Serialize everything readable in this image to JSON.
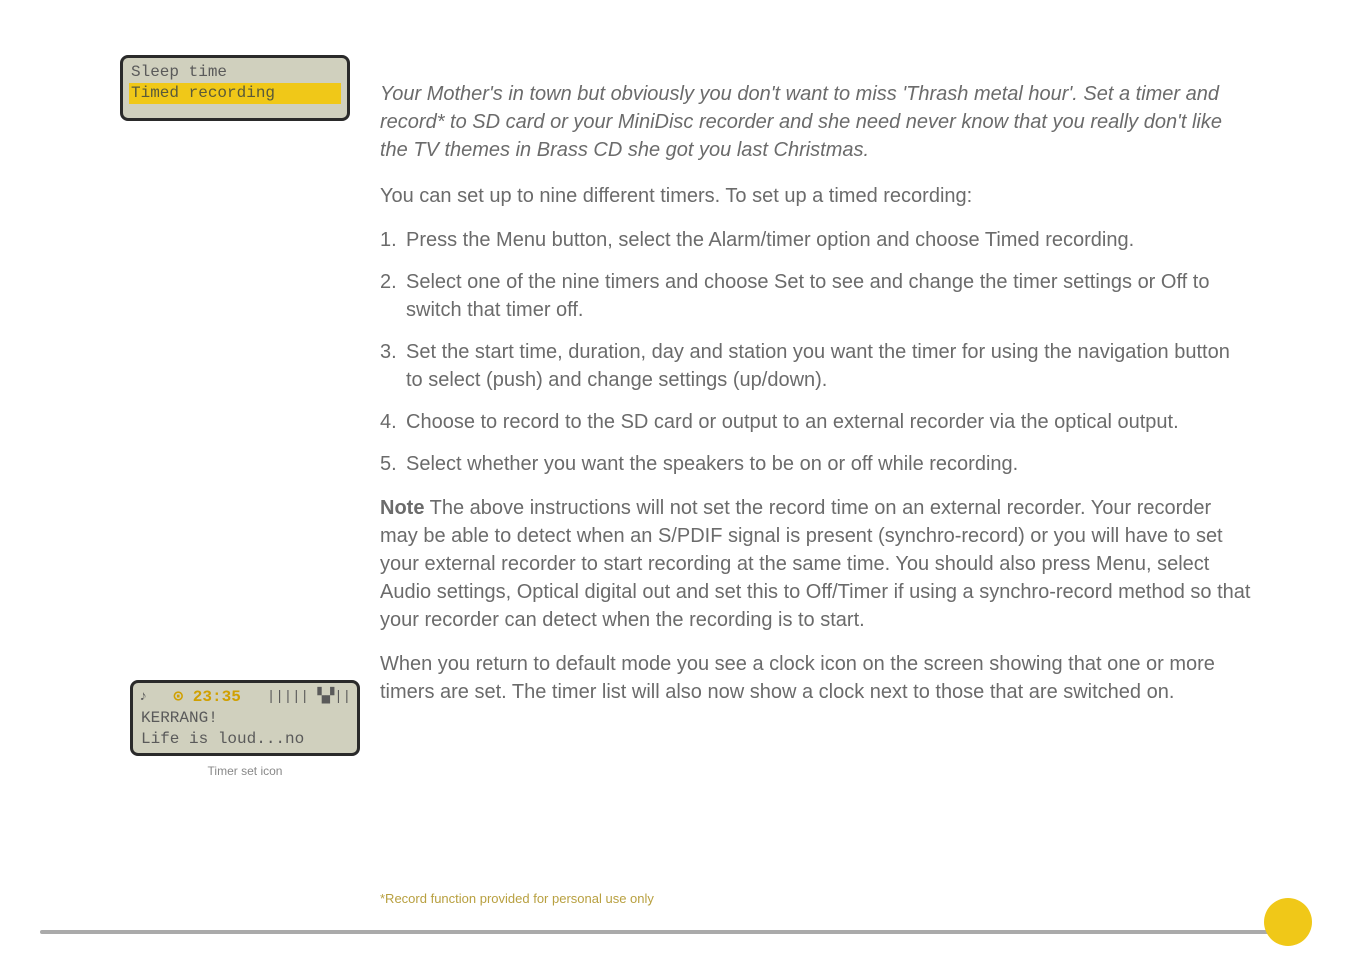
{
  "screen_top": {
    "line1": "Sleep time",
    "line2": "Timed recording"
  },
  "screen_bottom": {
    "left_symbol": "♪",
    "clock_icon": "⊙",
    "time": "23:35",
    "bars": "||||| ▚▞||",
    "station": "KERRANG!",
    "scroll": "Life is loud...no"
  },
  "caption_bottom": "Timer set icon",
  "intro": "Your Mother's in town but obviously you don't want to miss 'Thrash metal hour'. Set a timer and record* to SD card or your MiniDisc recorder and she need never know that you really don't like the TV themes in Brass CD she got you last Christmas.",
  "lead": "You can set up to nine different timers. To set up a timed recording:",
  "steps": [
    "Press the Menu button, select the Alarm/timer option and choose Timed recording.",
    "Select one of the nine timers and choose Set to see and change the timer settings or Off to switch that timer off.",
    "Set the start time, duration, day and station you want the timer for using the navigation button to select (push) and change settings (up/down).",
    "Choose to record to the SD card or output to an external recorder via the optical output.",
    "Select whether you want the speakers to be on or off while recording."
  ],
  "note_label": "Note",
  "note_body": " The above instructions will not set the record time on an external recorder. Your recorder may be able to detect when an S/PDIF signal is present (synchro-record) or you will have to set your external recorder to start recording at the same time. You should also press Menu, select Audio settings, Optical digital out and set this to Off/Timer if using a synchro-record method so that your recorder can detect when the recording is to start.",
  "closing": "When you return to default mode you see a clock icon on the screen showing that one or more timers are set. The timer list will also now show a clock next to those that are switched on.",
  "footnote": "*Record function provided for personal use only"
}
